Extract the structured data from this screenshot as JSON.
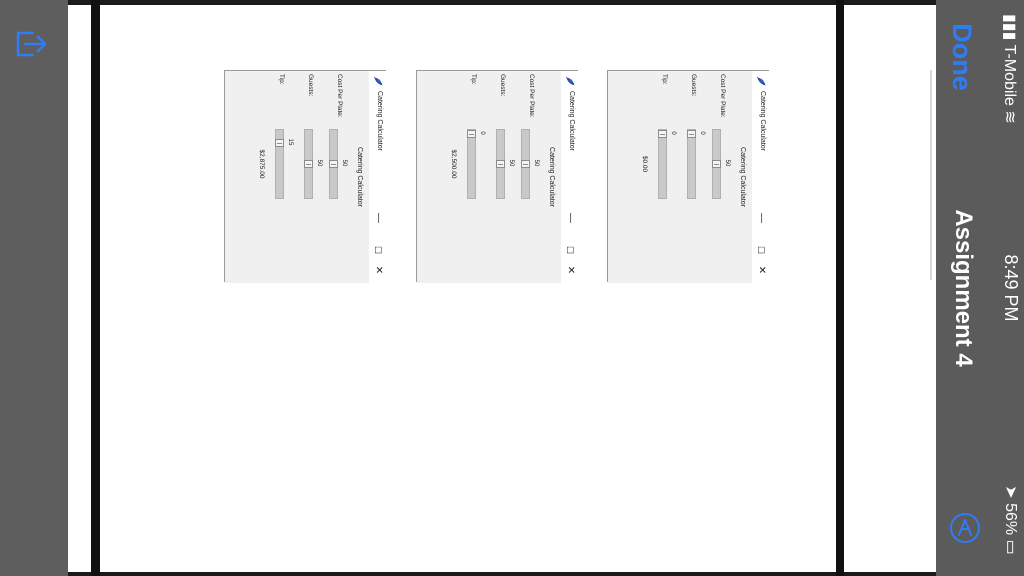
{
  "statusbar": {
    "carrier": "T-Mobile",
    "time": "8:49 PM",
    "battery": "56%"
  },
  "navbar": {
    "done_label": "Done",
    "title": "Assignment 4"
  },
  "windows": [
    {
      "title": "Catering Calculator",
      "heading": "Catering Calculator",
      "cost_label": "Cost Per Plate:",
      "cost_value": "50",
      "cost_fraction": 0.5,
      "guests_label": "Guests:",
      "guests_value": "0",
      "guests_fraction": 0.0,
      "tip_label": "Tip:",
      "tip_value": "0",
      "tip_fraction": 0.0,
      "total": "$0.00"
    },
    {
      "title": "Catering Calculator",
      "heading": "Catering Calculator",
      "cost_label": "Cost Per Plate:",
      "cost_value": "50",
      "cost_fraction": 0.5,
      "guests_label": "Guests:",
      "guests_value": "50",
      "guests_fraction": 0.5,
      "tip_label": "Tip:",
      "tip_value": "0",
      "tip_fraction": 0.0,
      "total": "$2,500.00"
    },
    {
      "title": "Catering Calculator",
      "heading": "Catering Calculator",
      "cost_label": "Cost Per Plate:",
      "cost_value": "50",
      "cost_fraction": 0.5,
      "guests_label": "Guests:",
      "guests_value": "50",
      "guests_fraction": 0.5,
      "tip_label": "Tip:",
      "tip_value": "15",
      "tip_fraction": 0.15,
      "total": "$2,875.00"
    }
  ],
  "icons": {
    "share": "share-exit-icon",
    "markup": "markup-pen-icon",
    "app": "feather-icon"
  },
  "colors": {
    "accent": "#2f7df6"
  }
}
